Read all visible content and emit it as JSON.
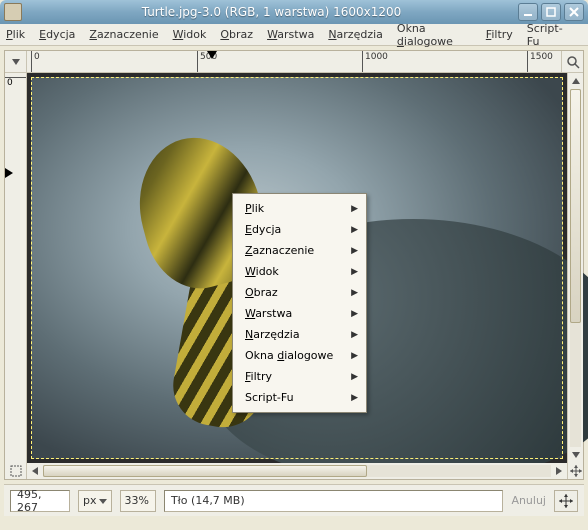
{
  "titlebar": {
    "title": "Turtle.jpg-3.0 (RGB, 1 warstwa) 1600x1200"
  },
  "menubar": {
    "plik": "Plik",
    "edycja": "Edycja",
    "zaznaczenie": "Zaznaczenie",
    "widok": "Widok",
    "obraz": "Obraz",
    "warstwa": "Warstwa",
    "narzedzia": "Narzędzia",
    "okna": "Okna dialogowe",
    "filtry": "Filtry",
    "scriptfu": "Script-Fu"
  },
  "ruler": {
    "t0": "0",
    "t500": "500",
    "t1000": "1000",
    "t1500": "1500",
    "v0": "0"
  },
  "context": {
    "plik": "Plik",
    "edycja": "Edycja",
    "zaznaczenie": "Zaznaczenie",
    "widok": "Widok",
    "obraz": "Obraz",
    "warstwa": "Warstwa",
    "narzedzia": "Narzędzia",
    "okna": "Okna dialogowe",
    "filtry": "Filtry",
    "scriptfu": "Script-Fu"
  },
  "status": {
    "coords": "495, 267",
    "unit": "px",
    "zoom": "33%",
    "layer": "Tło (14,7 MB)",
    "cancel": "Anuluj"
  }
}
